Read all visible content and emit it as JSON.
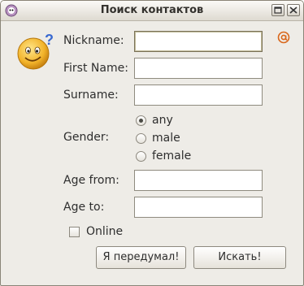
{
  "window": {
    "title": "Поиск контактов"
  },
  "form": {
    "nickname_label": "Nickname:",
    "firstname_label": "First Name:",
    "surname_label": "Surname:",
    "gender_label": "Gender:",
    "gender_options": [
      "any",
      "male",
      "female"
    ],
    "gender_selected": "any",
    "age_from_label": "Age from:",
    "age_to_label": "Age to:",
    "online_label": "Online",
    "online_checked": false,
    "nickname_value": "",
    "firstname_value": "",
    "surname_value": "",
    "age_from_value": "",
    "age_to_value": ""
  },
  "buttons": {
    "cancel_label": "Я передумал!",
    "search_label": "Искать!"
  },
  "icons": {
    "app": "qip-flower-icon",
    "avatar": "smiley-question-icon",
    "email": "at-sign-icon"
  },
  "colors": {
    "accent_at": "#e8a020",
    "title_bg": "#e9e6df"
  }
}
